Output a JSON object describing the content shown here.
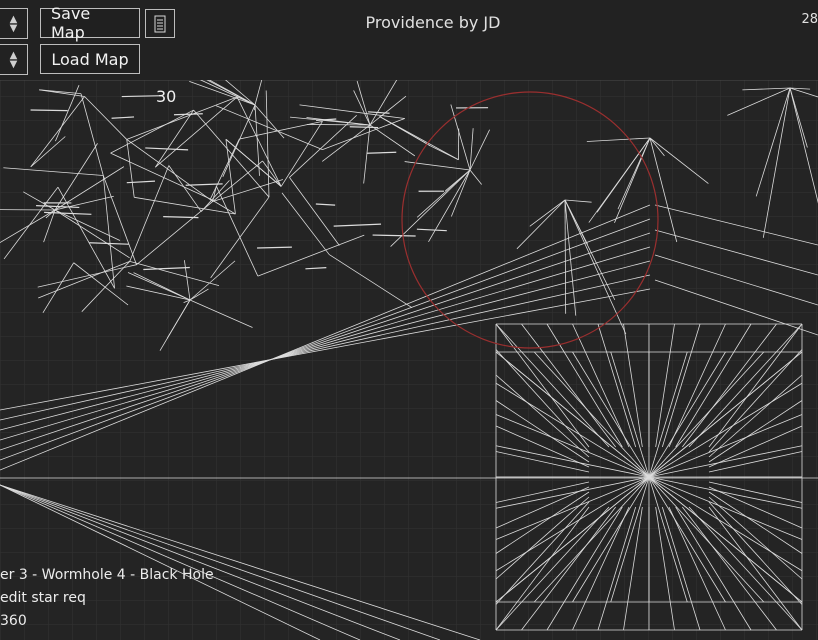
{
  "toolbar": {
    "save_label": "Save Map",
    "load_label": "Load Map",
    "title": "Providence by JD",
    "corner_value": "28"
  },
  "map": {
    "node_label": "30"
  },
  "status": {
    "line1": "er 3 - Wormhole 4 - Black Hole",
    "line2": "edit star req",
    "line3": "360"
  },
  "colors": {
    "background": "#242424",
    "grid": "#2f2f2f",
    "lines": "#f0f0f0",
    "range_circle": "#9a2f2f"
  }
}
